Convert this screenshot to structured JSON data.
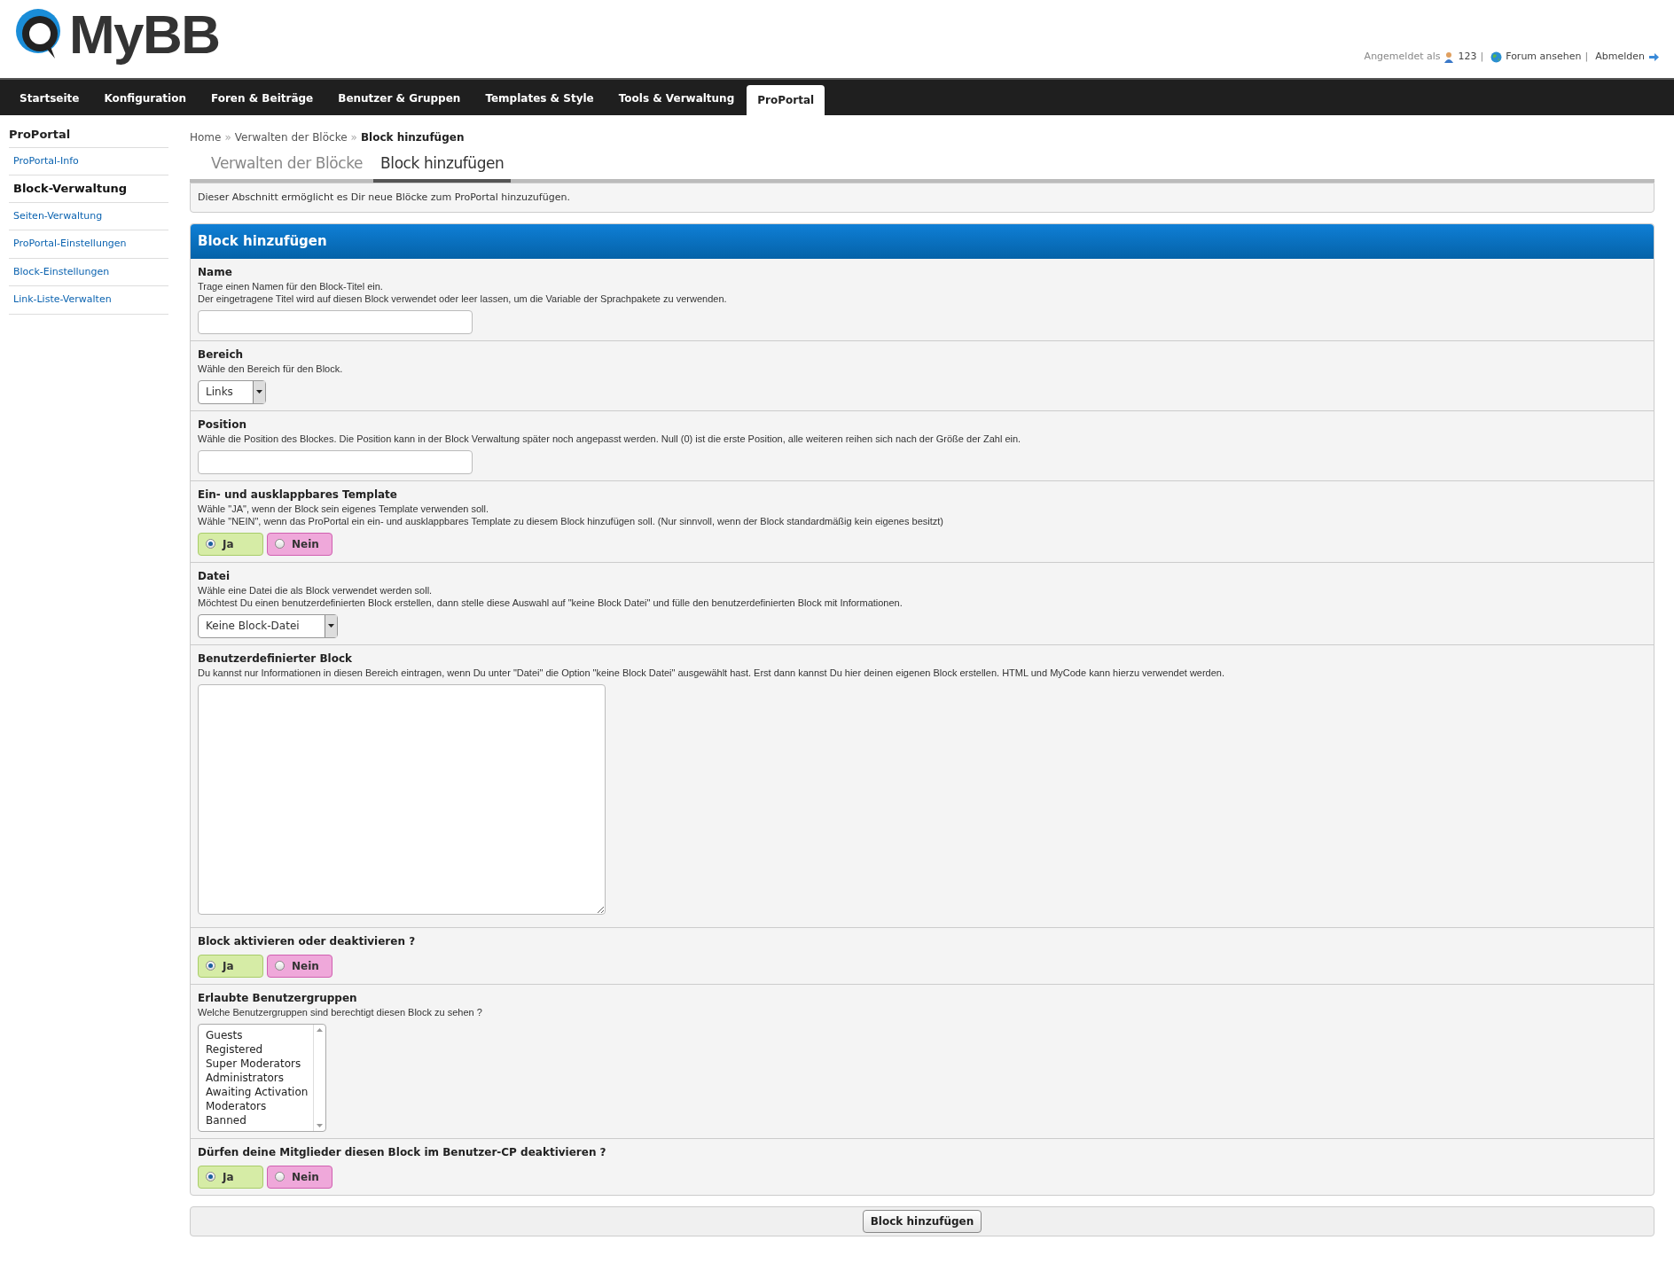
{
  "logo": {
    "text": "MyBB"
  },
  "user_bar": [
    {
      "kind": "text",
      "text": "Angemeldet als"
    },
    {
      "kind": "link",
      "text": "123"
    },
    {
      "kind": "sep",
      "text": "|"
    },
    {
      "kind": "link",
      "text": "Forum ansehen"
    },
    {
      "kind": "sep",
      "text": "|"
    },
    {
      "kind": "link",
      "text": "Abmelden"
    }
  ],
  "nav": [
    {
      "label": "Startseite",
      "selected": false
    },
    {
      "label": "Konfiguration",
      "selected": false
    },
    {
      "label": "Foren & Beiträge",
      "selected": false
    },
    {
      "label": "Benutzer & Gruppen",
      "selected": false
    },
    {
      "label": "Templates & Style",
      "selected": false
    },
    {
      "label": "Tools & Verwaltung",
      "selected": false
    },
    {
      "label": "ProPortal",
      "selected": true
    }
  ],
  "sidebar": {
    "title": "ProPortal",
    "items": [
      {
        "label": "ProPortal-Info",
        "selected": false
      },
      {
        "label": "Block-Verwaltung",
        "selected": true
      },
      {
        "label": "Seiten-Verwaltung",
        "selected": false
      },
      {
        "label": "ProPortal-Einstellungen",
        "selected": false
      },
      {
        "label": "Block-Einstellungen",
        "selected": false
      },
      {
        "label": "Link-Liste-Verwalten",
        "selected": false
      }
    ]
  },
  "breadcrumb": [
    {
      "text": "Home"
    },
    {
      "text": "Verwalten der Blöcke"
    },
    {
      "text": "Block hinzufügen"
    }
  ],
  "breadcrumb_separator": "»",
  "tabs": [
    {
      "label": "Verwalten der Blöcke",
      "selected": false
    },
    {
      "label": "Block hinzufügen",
      "selected": true
    }
  ],
  "info": "Dieser Abschnitt ermöglicht es Dir neue Blöcke zum ProPortal hinzuzufügen.",
  "form": {
    "title": "Block hinzufügen",
    "rows": [
      {
        "kind": "text",
        "label": "Name",
        "description": [
          "Trage einen Namen für den Block-Titel ein.",
          "Der eingetragene Titel wird auf diesen Block verwendet oder leer lassen, um die Variable der Sprachpakete zu verwenden."
        ]
      },
      {
        "kind": "select",
        "label": "Bereich",
        "description": [
          "Wähle den Bereich für den Block."
        ],
        "value": "Links"
      },
      {
        "kind": "text",
        "label": "Position",
        "description": [
          "Wähle die Position des Blockes. Die Position kann in der Block Verwaltung später noch angepasst werden. Null (0) ist die erste Position, alle weiteren reihen sich nach der Größe der Zahl ein."
        ]
      },
      {
        "kind": "radio",
        "label": "Ein- und ausklappbares Template",
        "description": [
          "Wähle \"JA\", wenn der Block sein eigenes Template verwenden soll.",
          "Wähle \"NEIN\", wenn das ProPortal ein ein- und ausklappbares Template zu diesem Block hinzufügen soll. (Nur sinnvoll, wenn der Block standardmäßig kein eigenes besitzt)"
        ],
        "options": [
          {
            "label": "Ja",
            "selected": true,
            "color": "#d6eca6"
          },
          {
            "label": "Nein",
            "selected": false,
            "color": "#efa8da"
          }
        ]
      },
      {
        "kind": "select",
        "label": "Datei",
        "description": [
          "Wähle eine Datei die als Block verwendet werden soll.",
          "Möchtest Du einen benutzerdefinierten Block erstellen, dann stelle diese Auswahl auf \"keine Block Datei\" und fülle den benutzerdefinierten Block mit Informationen."
        ],
        "value": "Keine Block-Datei"
      },
      {
        "kind": "textarea",
        "label": "Benutzerdefinierter Block",
        "description": [
          "Du kannst nur Informationen in diesen Bereich eintragen, wenn Du unter \"Datei\" die Option \"keine Block Datei\" ausgewählt hast. Erst dann kannst Du hier deinen eigenen Block erstellen. HTML und MyCode kann hierzu verwendet werden."
        ]
      },
      {
        "kind": "radio",
        "label": "Block aktivieren oder deaktivieren ?",
        "options": [
          {
            "label": "Ja",
            "selected": true,
            "color": "#d6eca6"
          },
          {
            "label": "Nein",
            "selected": false,
            "color": "#efa8da"
          }
        ]
      },
      {
        "kind": "multiselect",
        "label": "Erlaubte Benutzergruppen",
        "description": [
          "Welche Benutzergruppen sind berechtigt diesen Block zu sehen ?"
        ],
        "options": [
          {
            "label": "Guests",
            "selected": false
          },
          {
            "label": "Registered",
            "selected": false
          },
          {
            "label": "Super Moderators",
            "selected": false
          },
          {
            "label": "Administrators",
            "selected": false
          },
          {
            "label": "Awaiting Activation",
            "selected": false
          },
          {
            "label": "Moderators",
            "selected": false
          },
          {
            "label": "Banned",
            "selected": false
          }
        ]
      },
      {
        "kind": "radio",
        "label": "Dürfen deine Mitglieder diesen Block im Benutzer-CP deaktivieren ?",
        "options": [
          {
            "label": "Ja",
            "selected": true,
            "color": "#d6eca6"
          },
          {
            "label": "Nein",
            "selected": false,
            "color": "#efa8da"
          }
        ]
      }
    ]
  },
  "submit": "Block hinzufügen"
}
